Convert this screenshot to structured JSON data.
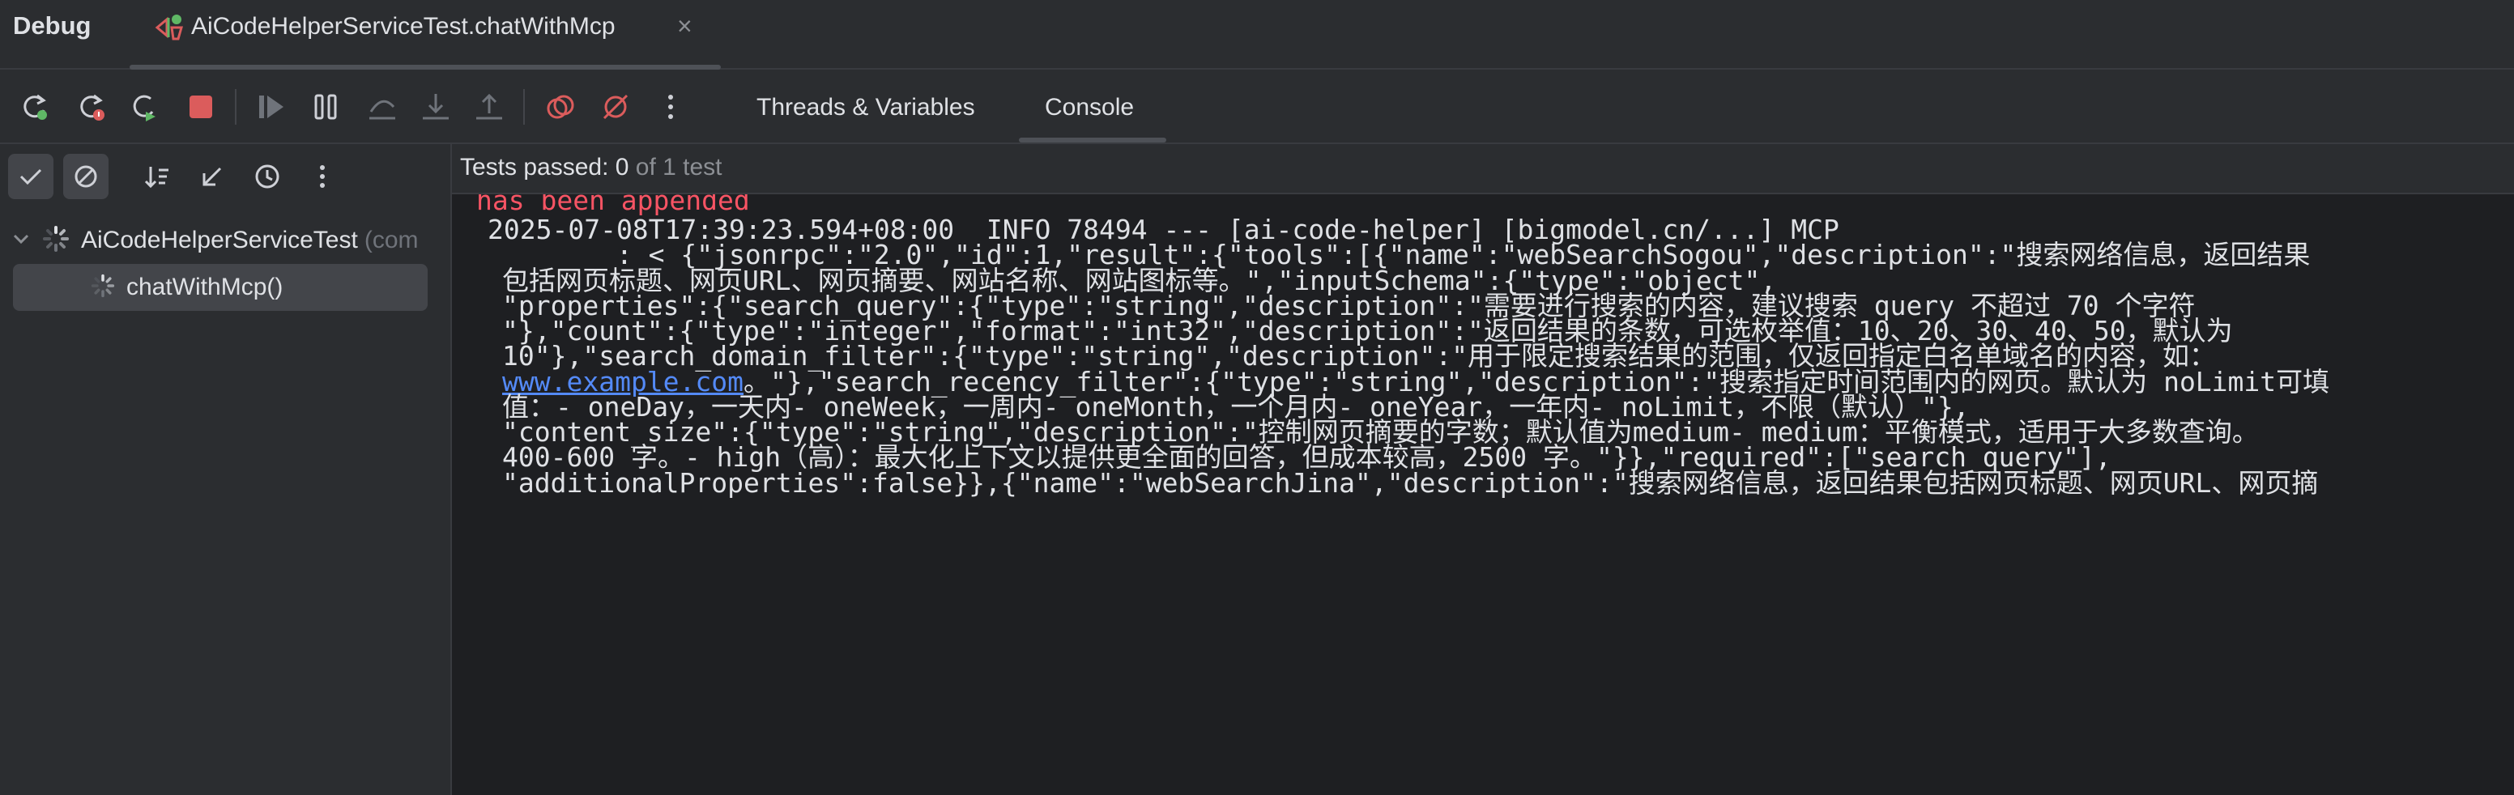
{
  "window": {
    "section_title": "Debug",
    "run_tab_label": "AiCodeHelperServiceTest.chatWithMcp",
    "run_tab_close": "×"
  },
  "toolbar": {
    "icons": [
      "rerun-icon",
      "rerun-failed-icon",
      "rerun-auto-icon",
      "stop-icon",
      "resume-icon",
      "pause-icon",
      "step-over-icon",
      "step-into-icon",
      "step-out-icon",
      "view-breakpoints-icon",
      "mute-breakpoints-icon",
      "more-icon"
    ],
    "tabs": [
      {
        "label": "Threads & Variables",
        "selected": false
      },
      {
        "label": "Console",
        "selected": true
      }
    ]
  },
  "test_tree": {
    "toolbar_icons": [
      "show-passed-icon",
      "show-ignored-icon",
      "sort-icon",
      "collapse-icon",
      "history-icon",
      "more-icon"
    ],
    "root": {
      "name": "AiCodeHelperServiceTest",
      "suffix": "(com",
      "status": "running"
    },
    "child": {
      "name": "chatWithMcp()",
      "status": "running"
    }
  },
  "console": {
    "status_prefix": "Tests passed: ",
    "status_count": "0",
    "status_suffix": " of 1 test",
    "lines": {
      "l0": "has been appended",
      "l1": "2025-07-08T17:39:23.594+08:00  INFO 78494 --- [ai-code-helper] [bigmodel.cn/...] MCP",
      "l2": "        : < {\"jsonrpc\":\"2.0\",\"id\":1,\"result\":{\"tools\":[{\"name\":\"webSearchSogou\",\"description\":\"搜索网络信息，返回结果",
      "l3": "包括网页标题、网页URL、网页摘要、网站名称、网站图标等。\",\"inputSchema\":{\"type\":\"object\",",
      "l4": "\"properties\":{\"search_query\":{\"type\":\"string\",\"description\":\"需要进行搜索的内容，建议搜索 query 不超过 70 个字符",
      "l5": "\"},\"count\":{\"type\":\"integer\",\"format\":\"int32\",\"description\":\"返回结果的条数，可选枚举值：10、20、30、40、50，默认为",
      "l6": "10\"},\"search_domain_filter\":{\"type\":\"string\",\"description\":\"用于限定搜索结果的范围，仅返回指定白名单域名的内容，如：",
      "l7_link": "www.example.com",
      "l7_rest": "。\"},\"search_recency_filter\":{\"type\":\"string\",\"description\":\"搜索指定时间范围内的网页。默认为 noLimit可填",
      "l8": "值：- oneDay，一天内- oneWeek，一周内- oneMonth，一个月内- oneYear，一年内- noLimit，不限（默认）\"},",
      "l9": "\"content_size\":{\"type\":\"string\",\"description\":\"控制网页摘要的字数；默认值为medium- medium：平衡模式，适用于大多数查询。",
      "l10": "400-600 字。- high（高）：最大化上下文以提供更全面的回答，但成本较高，2500 字。\"}},\"required\":[\"search_query\"],",
      "l11": "\"additionalProperties\":false}},{\"name\":\"webSearchJina\",\"description\":\"搜索网络信息，返回结果包括网页标题、网页URL、网页摘"
    }
  },
  "colors": {
    "background": "#1e1f22",
    "panel": "#2b2d30",
    "text": "#dfe1e5",
    "error_text": "#f75464",
    "link": "#548af7",
    "stop_red": "#db5c5c",
    "rerun_green": "#5fb865"
  }
}
